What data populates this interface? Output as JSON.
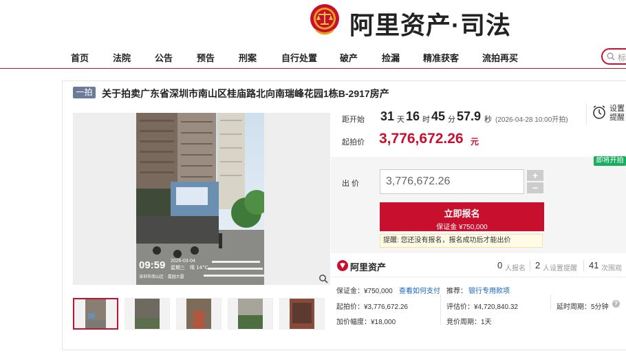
{
  "header": {
    "logo_text": "阿里资产·司法"
  },
  "nav": {
    "items": [
      "首页",
      "法院",
      "公告",
      "预告",
      "刑案",
      "自行处置",
      "破产",
      "捡漏",
      "精准获客",
      "流拍再买"
    ],
    "search_placeholder": "标"
  },
  "auction": {
    "stage": "一拍",
    "title": "关于拍卖广东省深圳市南山区桂庙路北向南瑞峰花园1栋B-2917房产",
    "photo": {
      "time": "09:59",
      "date": "2026-03-04",
      "weekday": "星期三",
      "temp": "晴 14°C",
      "location": "深圳市南山区 · 嘉园大厦"
    },
    "countdown": {
      "label": "距开始",
      "days": "31",
      "days_unit": "天",
      "hours": "16",
      "hours_unit": "时",
      "minutes": "45",
      "minutes_unit": "分",
      "seconds": "57.9",
      "seconds_unit": "秒",
      "start_note": "(2026-04-28 10:00开拍)"
    },
    "reminder": {
      "label": "设置提醒"
    },
    "start_price": {
      "label": "起拍价",
      "value": "3,776,672.26",
      "unit": "元"
    },
    "badge": "即将开拍",
    "bid": {
      "label": "出 价",
      "input_value": "3,776,672.26",
      "plus": "+",
      "minus": "−"
    },
    "register": {
      "main": "立即报名",
      "deposit": "保证金 ¥750,000"
    },
    "tip": {
      "label": "提醒:",
      "text": "您还没有报名，报名成功后才能出价"
    },
    "stats": {
      "brand": "阿里资产",
      "signups": "0",
      "signups_label": "人报名",
      "reminders": "2",
      "reminders_label": "人设置提醒",
      "views": "41",
      "views_label": "次围观"
    },
    "details": {
      "deposit": "保证金：¥750,000",
      "how_to_pay": "查看如何支付",
      "recommend_label": "推荐：",
      "recommend_link": "银行专用款项",
      "start_price": "起拍价：¥3,776,672.26",
      "appraisal": "评估价：¥4,720,840.32",
      "delay": "延时周期：5分钟",
      "increment": "加价幅度：¥18,000",
      "cycle": "竞价周期：1天"
    }
  },
  "colors": {
    "brand_red": "#c8102e",
    "badge_green": "#1aad5f",
    "link_blue": "#1565c0"
  }
}
